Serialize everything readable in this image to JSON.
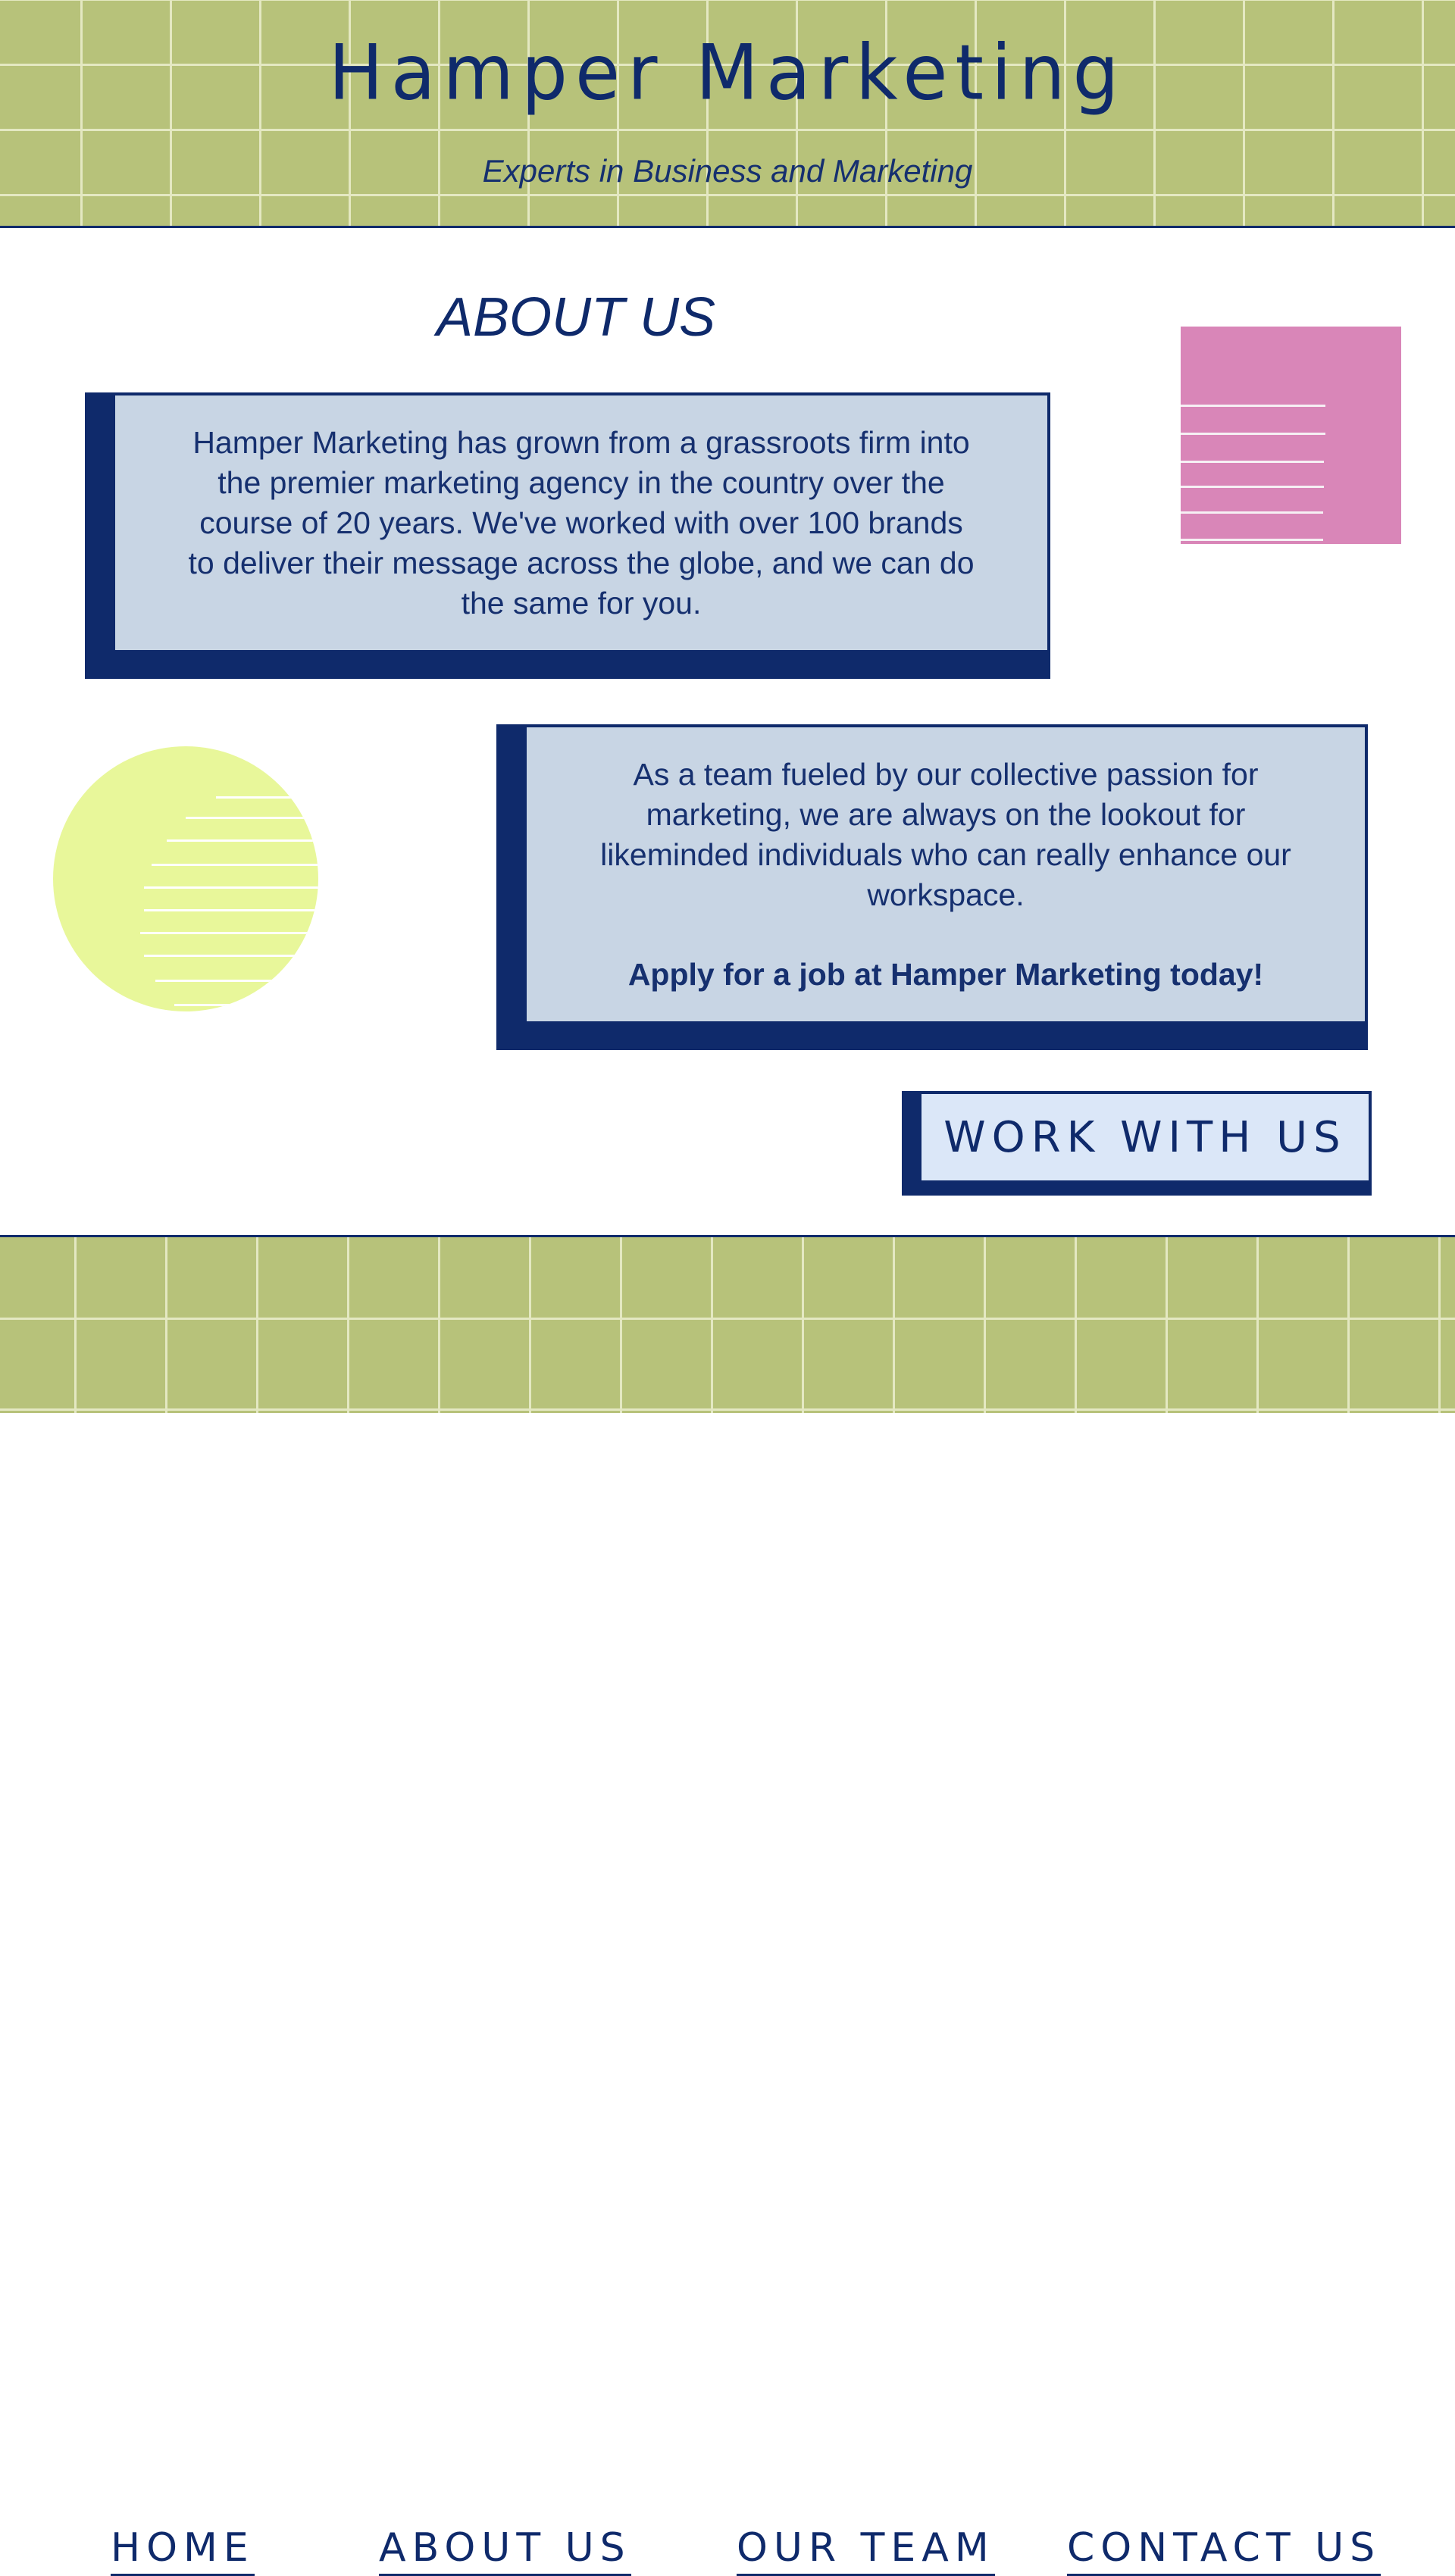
{
  "header": {
    "title": "Hamper Marketing",
    "subtitle": "Experts in Business and Marketing"
  },
  "main": {
    "heading": "ABOUT US",
    "card1_text": "Hamper Marketing has grown from a grassroots firm into the premier marketing agency in the country over the course of 20 years. We've worked with over 100 brands to deliver their message across the globe, and we can do the same for you.",
    "card2_text": "As a team fueled by our collective passion for marketing, we are always on the lookout for likeminded individuals who can really enhance our workspace.",
    "card2_cta": "Apply for a job at Hamper Marketing today!",
    "button_label": "WORK WITH US"
  },
  "nav": {
    "home": "HOME",
    "about": "ABOUT US",
    "team": "OUR TEAM",
    "contact": "CONTACT US"
  },
  "colors": {
    "band_green": "#b7c27a",
    "navy": "#0f2a6b",
    "card_blue": "#c8d5e4",
    "pink": "#d986b8",
    "lime_circle": "#e8f79a"
  }
}
